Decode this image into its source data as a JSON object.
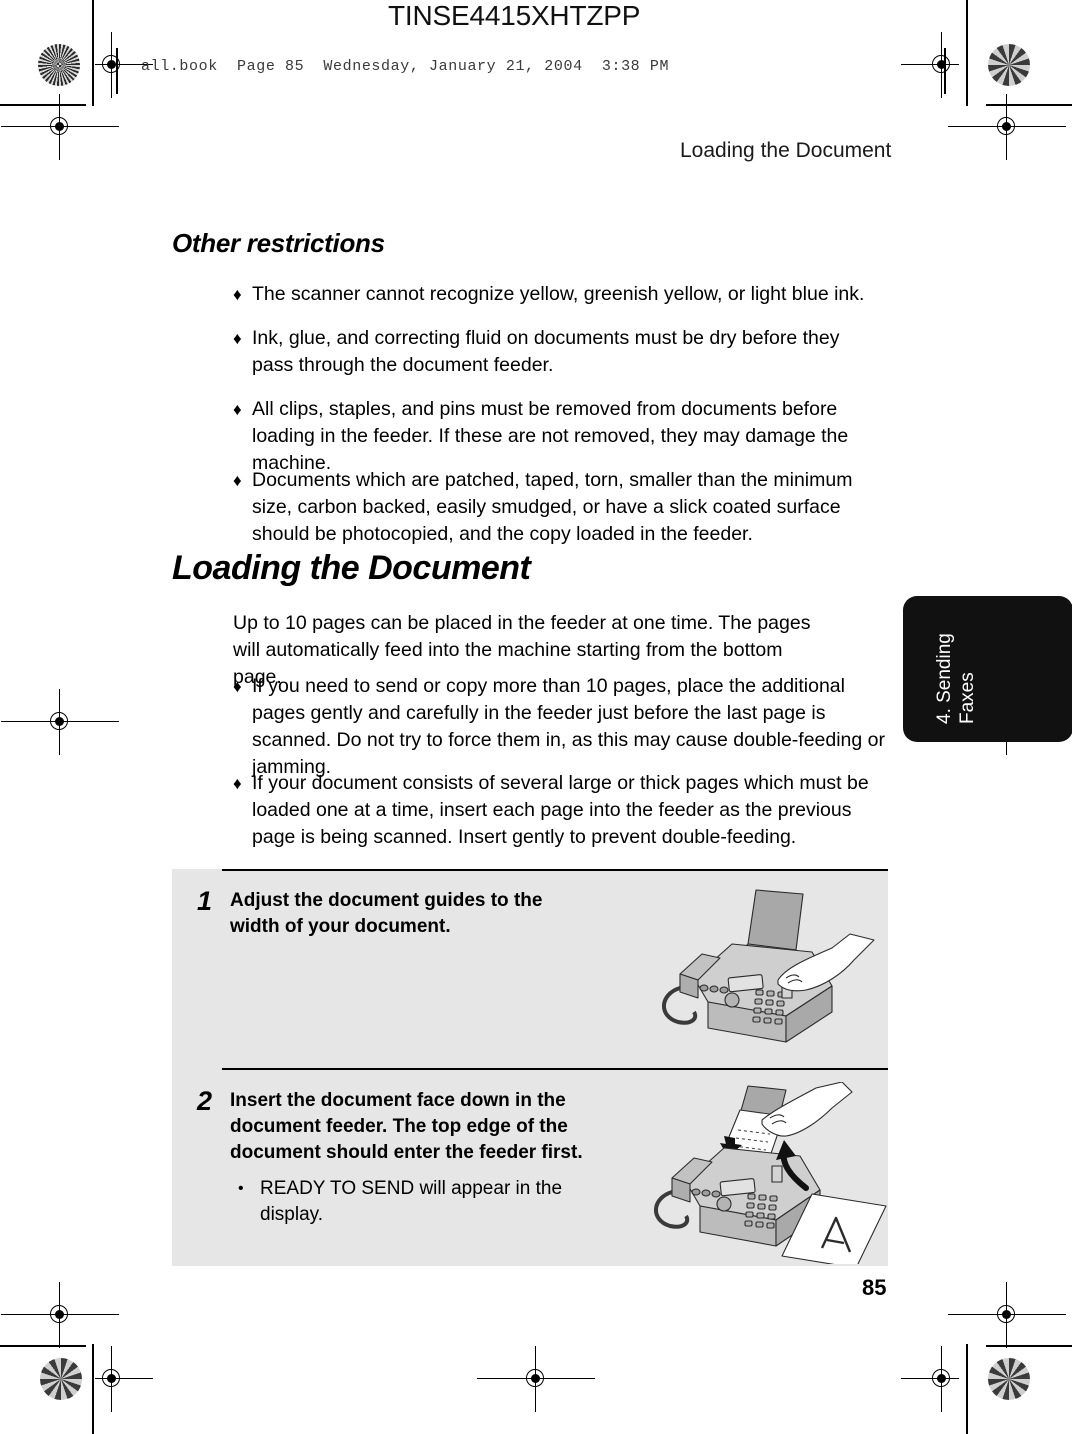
{
  "page": {
    "doc_code": "TINSE4415XHTZPP",
    "book_header": "all.book  Page 85  Wednesday, January 21, 2004  3:38 PM",
    "running_head": "Loading the Document",
    "folio": "85"
  },
  "chapter_tab": {
    "line1": "4. Sending",
    "line2": "Faxes"
  },
  "sections": [
    {
      "heading": "Other restrictions",
      "bullets": [
        "The scanner cannot recognize yellow, greenish yellow, or light blue ink.",
        "Ink, glue, and correcting fluid on documents must be dry before they pass through the document feeder.",
        "All clips, staples, and pins must be removed from documents before loading in the feeder. If these are not removed, they may damage the machine.",
        "Documents which are patched, taped, torn, smaller than the minimum size, carbon backed, easily smudged, or have a slick coated surface should be photocopied, and the copy loaded in the feeder."
      ]
    },
    {
      "heading": "Loading the Document",
      "intro": "Up to 10 pages can be placed in the feeder at one time. The pages will automatically feed into the machine starting from the bottom page.",
      "bullets": [
        "If you need to send or copy more than 10 pages, place the additional pages gently and carefully in the feeder just before the last page is scanned. Do not try to force them in, as this may cause double-feeding or jamming.",
        "If your document consists of several large or thick pages which must be loaded one at a time, insert each page into the feeder as the previous page is being scanned. Insert gently to prevent double-feeding."
      ]
    }
  ],
  "steps": [
    {
      "number": "1",
      "text": "Adjust the document guides to the width of your document.",
      "subitems": [],
      "illustration": "fax-machine-adjust-guides-illustration"
    },
    {
      "number": "2",
      "text": "Insert the document face down in the document feeder. The top edge of the document should enter the feeder first.",
      "subitems": [
        "READY TO SEND will appear in the display."
      ],
      "illustration": "fax-machine-insert-document-illustration"
    }
  ],
  "bullet_glyph": "♦",
  "subbullet_glyph": "•",
  "colors": {
    "panel_background": "#e6e6e6",
    "tab_background": "#111111",
    "text": "#000000"
  }
}
